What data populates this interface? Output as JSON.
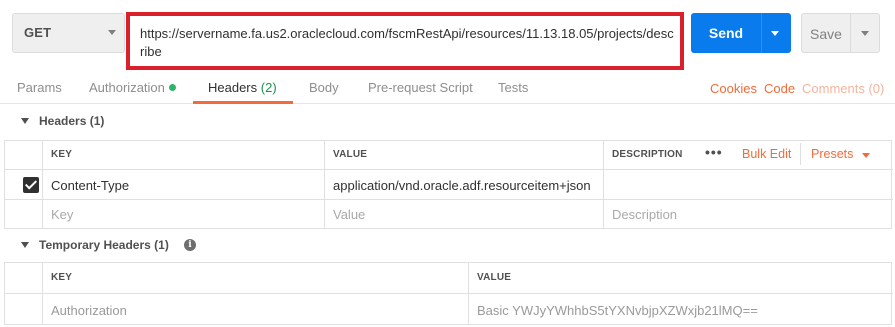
{
  "request": {
    "method": "GET",
    "url": "https://servername.fa.us2.oraclecloud.com/fscmRestApi/resources/11.13.18.05/projects/describe",
    "send_label": "Send",
    "save_label": "Save"
  },
  "tabs": {
    "params": "Params",
    "authorization": "Authorization",
    "headers": "Headers",
    "headers_count": "(2)",
    "body": "Body",
    "prerequest": "Pre-request Script",
    "tests": "Tests",
    "cookies": "Cookies",
    "code": "Code",
    "comments": "Comments (0)"
  },
  "headers_section": {
    "title": "Headers (1)",
    "col_key": "KEY",
    "col_value": "VALUE",
    "col_description": "DESCRIPTION",
    "bulk_edit": "Bulk Edit",
    "presets": "Presets",
    "rows": [
      {
        "checked": true,
        "key": "Content-Type",
        "value": "application/vnd.oracle.adf.resourceitem+json",
        "description": ""
      }
    ],
    "placeholder": {
      "key": "Key",
      "value": "Value",
      "description": "Description"
    }
  },
  "temp_headers_section": {
    "title": "Temporary Headers (1)",
    "col_key": "KEY",
    "col_value": "VALUE",
    "rows": [
      {
        "key": "Authorization",
        "value": "Basic YWJyYWhhbS5tYXNvbjpXZWxjb21lMQ=="
      }
    ]
  },
  "colors": {
    "accent": "#f26b3a",
    "send_blue": "#097bed",
    "highlight_red": "#d9202b",
    "status_green": "#2fb56a"
  }
}
